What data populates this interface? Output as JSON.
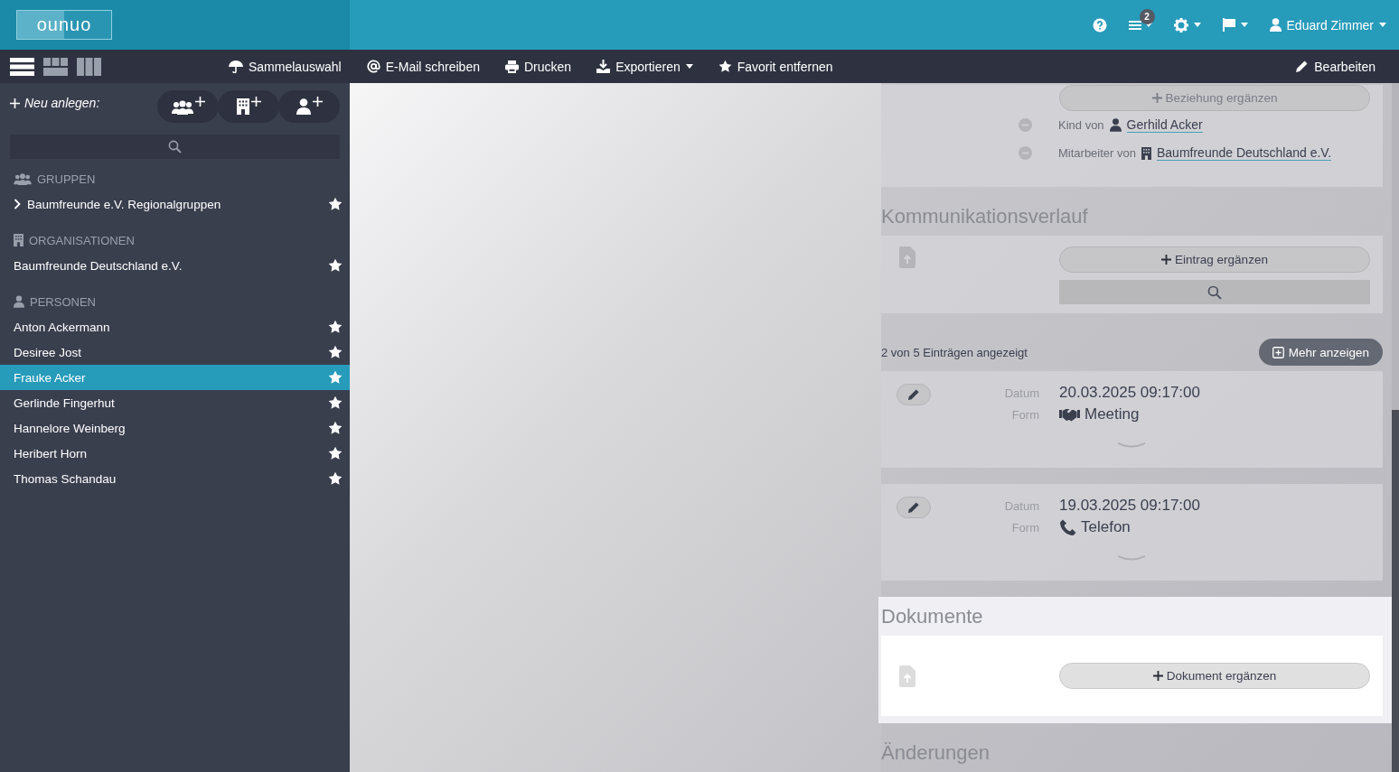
{
  "header": {
    "logo": "ounuo",
    "notification_count": "2",
    "user": "Eduard Zimmer"
  },
  "toolbar": {
    "view_modes": [
      {
        "kind": "list",
        "selected": true
      },
      {
        "kind": "tiles",
        "selected": false
      },
      {
        "kind": "columns",
        "selected": false
      }
    ],
    "actions": [
      {
        "kind": "umbrella",
        "label": "Sammelauswahl",
        "dropdown": false
      },
      {
        "kind": "at",
        "label": "E-Mail schreiben",
        "dropdown": false
      },
      {
        "kind": "print",
        "label": "Drucken",
        "dropdown": false
      },
      {
        "kind": "download",
        "label": "Exportieren",
        "dropdown": true
      },
      {
        "kind": "star",
        "label": "Favorit entfernen",
        "dropdown": false
      }
    ],
    "edit": "Bearbeiten"
  },
  "sidebar": {
    "new_label": "Neu anlegen:",
    "new_buttons": [
      {
        "kind": "group"
      },
      {
        "kind": "organization"
      },
      {
        "kind": "person"
      }
    ],
    "sections": [
      {
        "kind": "group",
        "title": "GRUPPEN",
        "items": [
          {
            "label": "Baumfreunde e.V. Regionalgruppen",
            "selected": false,
            "expanded": false
          }
        ]
      },
      {
        "kind": "organization",
        "title": "ORGANISATIONEN",
        "items": [
          {
            "label": "Baumfreunde Deutschland e.V.",
            "selected": false
          }
        ]
      },
      {
        "kind": "person",
        "title": "PERSONEN",
        "items": [
          {
            "label": "Anton Ackermann",
            "selected": false
          },
          {
            "label": "Desiree Jost",
            "selected": false
          },
          {
            "label": "Frauke Acker",
            "selected": true
          },
          {
            "label": "Gerlinde Fingerhut",
            "selected": false
          },
          {
            "label": "Hannelore Weinberg",
            "selected": false
          },
          {
            "label": "Heribert Horn",
            "selected": false
          },
          {
            "label": "Thomas Schandau",
            "selected": false
          }
        ]
      }
    ]
  },
  "relations": {
    "add_button": "Beziehung ergänzen",
    "items": [
      {
        "relation": "Kind von",
        "kind": "person",
        "name": "Gerhild Acker"
      },
      {
        "relation": "Mitarbeiter von",
        "kind": "organization",
        "name": "Baumfreunde Deutschland e.V."
      }
    ]
  },
  "communication": {
    "title": "Kommunikationsverlauf",
    "add_button": "Eintrag ergänzen",
    "count_text": "2 von 5 Einträgen angezeigt",
    "more_button": "Mehr anzeigen",
    "entries": [
      {
        "date_label": "Datum",
        "date": "20.03.2025 09:17:00",
        "form_label": "Form",
        "form": "Meeting",
        "kind": "meeting"
      },
      {
        "date_label": "Datum",
        "date": "19.03.2025 09:17:00",
        "form_label": "Form",
        "form": "Telefon",
        "kind": "phone"
      }
    ]
  },
  "documents": {
    "title": "Dokumente",
    "add_button": "Dokument ergänzen"
  },
  "changes": {
    "title": "Änderungen"
  }
}
